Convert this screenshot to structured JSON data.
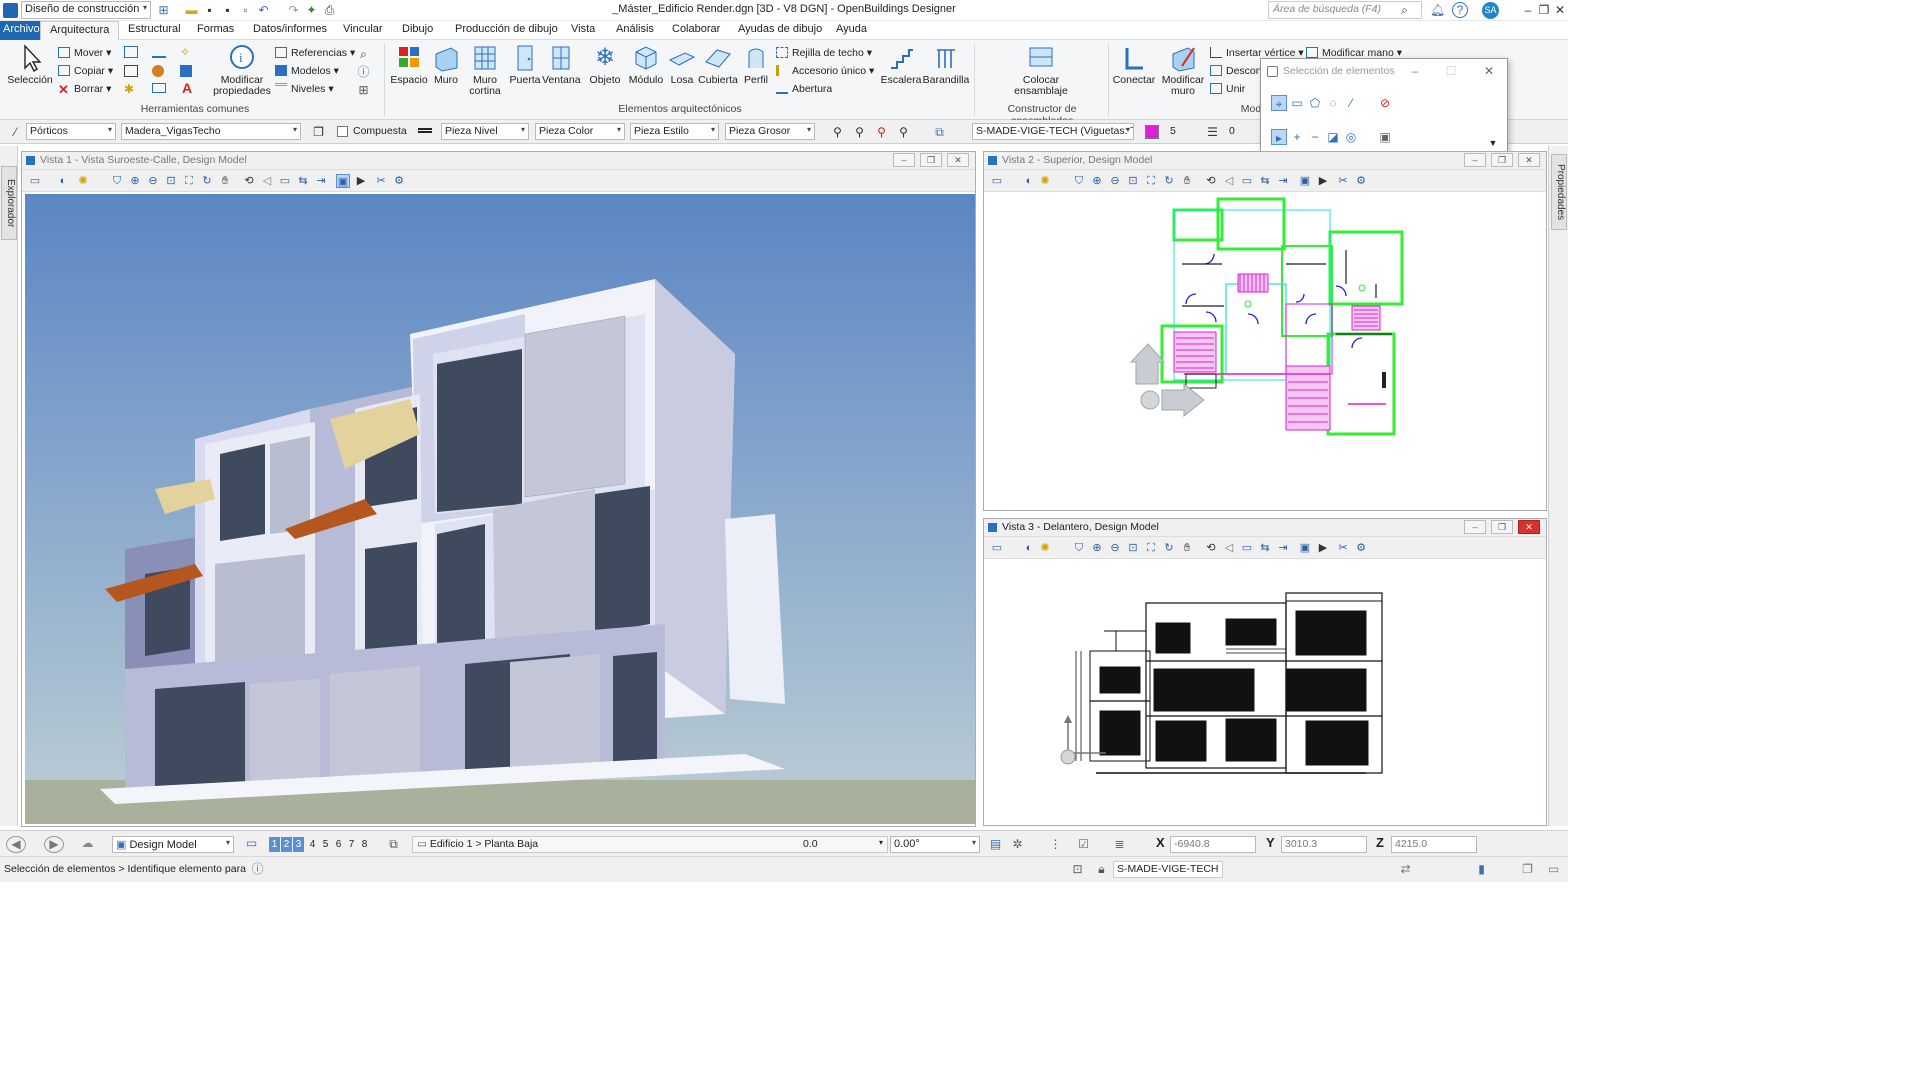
{
  "titlebar": {
    "workflow": "Diseño de construcción",
    "title": "_Máster_Edificio Render.dgn [3D - V8 DGN] - OpenBuildings Designer",
    "search_placeholder": "Área de búsqueda (F4)",
    "user_initials": "SA"
  },
  "menu": {
    "file": "Archivo",
    "tabs": [
      "Arquitectura",
      "Estructural",
      "Formas",
      "Datos/informes",
      "Vincular",
      "Dibujo",
      "Producción de dibujo",
      "Vista",
      "Análisis",
      "Colaborar",
      "Ayudas de dibujo",
      "Ayuda"
    ],
    "active_tab": "Arquitectura"
  },
  "ribbon": {
    "common": {
      "label": "Herramientas comunes",
      "selection": "Selección",
      "move": "Mover",
      "copy": "Copiar",
      "delete": "Borrar",
      "modify_props": "Modificar propiedades",
      "references": "Referencias",
      "models": "Modelos",
      "levels": "Niveles"
    },
    "arch": {
      "label": "Elementos arquitectónicos",
      "space": "Espacio",
      "wall": "Muro",
      "curtain_wall": "Muro cortina",
      "door": "Puerta",
      "window": "Ventana",
      "object": "Objeto",
      "module": "Módulo",
      "slab": "Losa",
      "roof": "Cubierta",
      "profile": "Perfil",
      "ceiling_grid": "Rejilla de techo",
      "single_fitting": "Accesorio único",
      "opening": "Abertura",
      "stair": "Escalera",
      "railing": "Barandilla"
    },
    "assembly": {
      "label": "Constructor de ensamblados",
      "place": "Colocar ensamblaje"
    },
    "modify": {
      "label": "Mod",
      "connect": "Conectar",
      "modify_wall": "Modificar muro",
      "insert_vertex": "Insertar vértice",
      "modify_hand": "Modificar mano",
      "disconnect": "Descon",
      "join": "Unir"
    }
  },
  "attributes": {
    "family": "Pórticos",
    "part": "Madera_VigasTecho",
    "compound": "Compuesta",
    "level": "Pieza Nivel",
    "color": "Pieza Color",
    "style": "Pieza Estilo",
    "weight": "Pieza Grosor",
    "standard": "S-MADE-VIGE-TECH (Viguetas: Te",
    "color_num": "5",
    "weight_num": "0"
  },
  "selection_panel": {
    "title": "Selección de elementos"
  },
  "sidebar": {
    "left_tab": "Explorador",
    "right_tab": "Propiedades"
  },
  "views": {
    "v1": {
      "title": "Vista 1 - Vista Suroeste-Calle, Design Model"
    },
    "v2": {
      "title": "Vista 2 - Superior, Design Model"
    },
    "v3": {
      "title": "Vista 3 - Delantero, Design Model"
    }
  },
  "status": {
    "model": "Design Model",
    "view_numbers": [
      "1",
      "2",
      "3",
      "4",
      "5",
      "6",
      "7",
      "8"
    ],
    "active_level": "Edificio 1 > Planta Baja",
    "elevation": "0.0",
    "angle": "0.00°",
    "x_label": "X",
    "x": "-6940.8",
    "y_label": "Y",
    "y": "3010.3",
    "z_label": "Z",
    "z": "4215.0",
    "prompt": "Selección de elementos > Identifique elemento para",
    "active_standard": "S-MADE-VIGE-TECH (Vig"
  },
  "colors": {
    "file_tab": "#1f66b3",
    "sky_top": "#5b86c4",
    "sky_bottom": "#b6c9d4",
    "ground": "#a9b19c",
    "plan_green": "#33ee33",
    "plan_magenta": "#e01fd6",
    "plan_cyan": "#22e0e0",
    "plan_blue": "#1e1ee8"
  }
}
